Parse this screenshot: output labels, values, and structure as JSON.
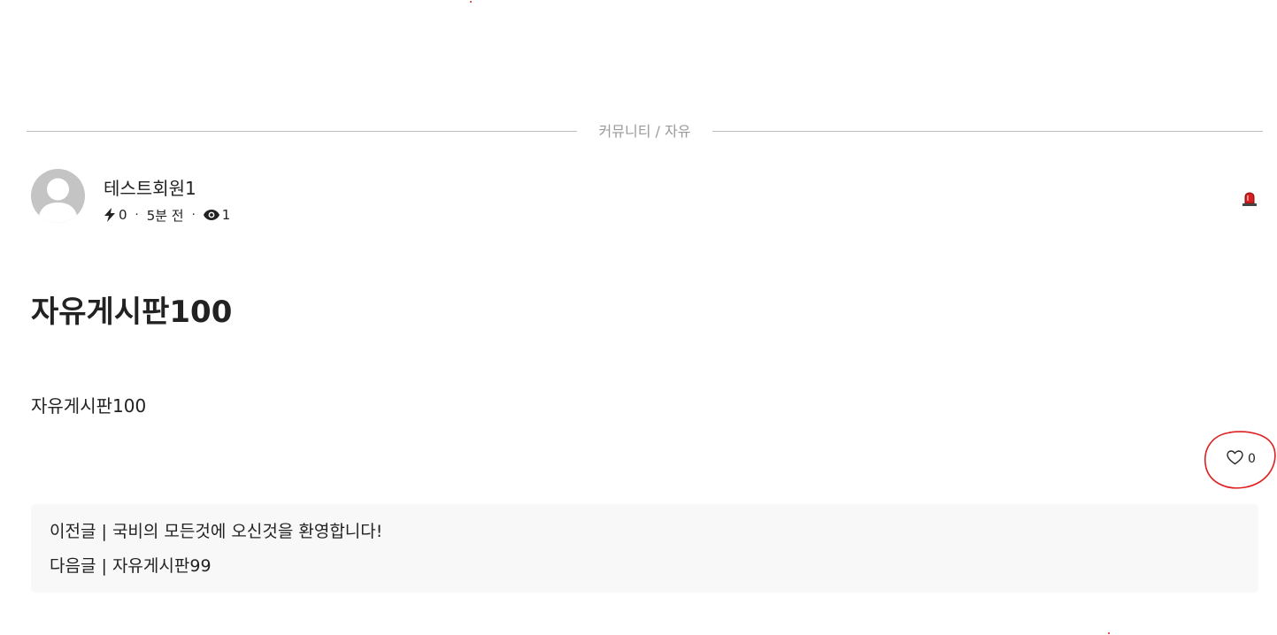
{
  "breadcrumb": {
    "text": "커뮤니티 / 자유"
  },
  "author": {
    "name": "테스트회원1",
    "points": "0",
    "posted_ago": "5분 전",
    "views": "1",
    "meta_separator": "·"
  },
  "post": {
    "title": "자유게시판100",
    "body": "자유게시판100"
  },
  "like": {
    "count": "0"
  },
  "navigation": {
    "prev_label": "이전글",
    "prev_title": "국비의 모든것에 오신것을 환영합니다!",
    "next_label": "다음글",
    "next_title": "자유게시판99",
    "divider": "|"
  },
  "icons": {
    "points": "bolt-icon",
    "views": "eye-icon",
    "report": "siren-icon",
    "like": "heart-icon"
  },
  "colors": {
    "annotation": "#e02020",
    "siren": "#d81f1f",
    "nav_background": "#f8f8f8",
    "avatar": "#c4c4c4"
  }
}
